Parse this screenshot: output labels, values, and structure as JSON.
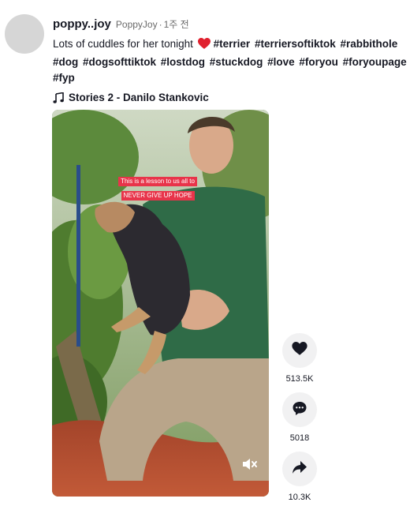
{
  "author": {
    "username": "poppy..joy",
    "nickname": "PoppyJoy",
    "separator": "·",
    "time": "1주 전"
  },
  "caption": {
    "text": "Lots of cuddles for her tonight",
    "emoji": "red-heart",
    "hashtags": [
      "#terrier",
      "#terriersoftiktok",
      "#rabbithole",
      "#dog",
      "#dogsofttiktok",
      "#lostdog",
      "#stuckdog",
      "#love",
      "#foryou",
      "#foryoupage",
      "#fyp"
    ]
  },
  "music": {
    "title": "Stories 2 - Danilo Stankovic",
    "icon": "music-note-icon"
  },
  "video": {
    "overlay_line1": "This is a lesson to us all to",
    "overlay_line2": "NEVER GIVE UP HOPE",
    "mute_icon": "muted-speaker-icon"
  },
  "actions": {
    "likes": "513.5K",
    "comments": "5018",
    "shares": "10.3K"
  },
  "colors": {
    "accent": "#e8344a",
    "button_bg": "#f1f1f2",
    "text": "#161823",
    "muted_text": "#6b6b6b"
  }
}
